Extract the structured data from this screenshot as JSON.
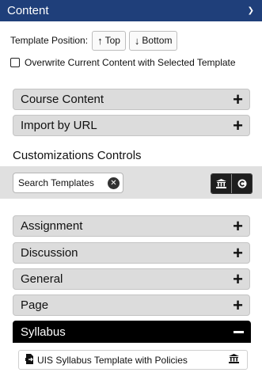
{
  "header": {
    "title": "Content",
    "chevron_icon": "chevron-down-icon"
  },
  "template_position": {
    "label": "Template Position:",
    "top_label": "Top",
    "bottom_label": "Bottom"
  },
  "overwrite": {
    "label": "Overwrite Current Content with Selected Template",
    "checked": false
  },
  "sections_top": [
    {
      "label": "Course Content"
    },
    {
      "label": "Import by URL"
    }
  ],
  "customizations": {
    "title": "Customizations Controls",
    "search_placeholder": "Search Templates"
  },
  "categories": [
    {
      "label": "Assignment"
    },
    {
      "label": "Discussion"
    },
    {
      "label": "General"
    },
    {
      "label": "Page"
    }
  ],
  "syllabus": {
    "label": "Syllabus",
    "expanded": true,
    "items": [
      {
        "label": "UIS Syllabus Template with Policies"
      }
    ]
  }
}
